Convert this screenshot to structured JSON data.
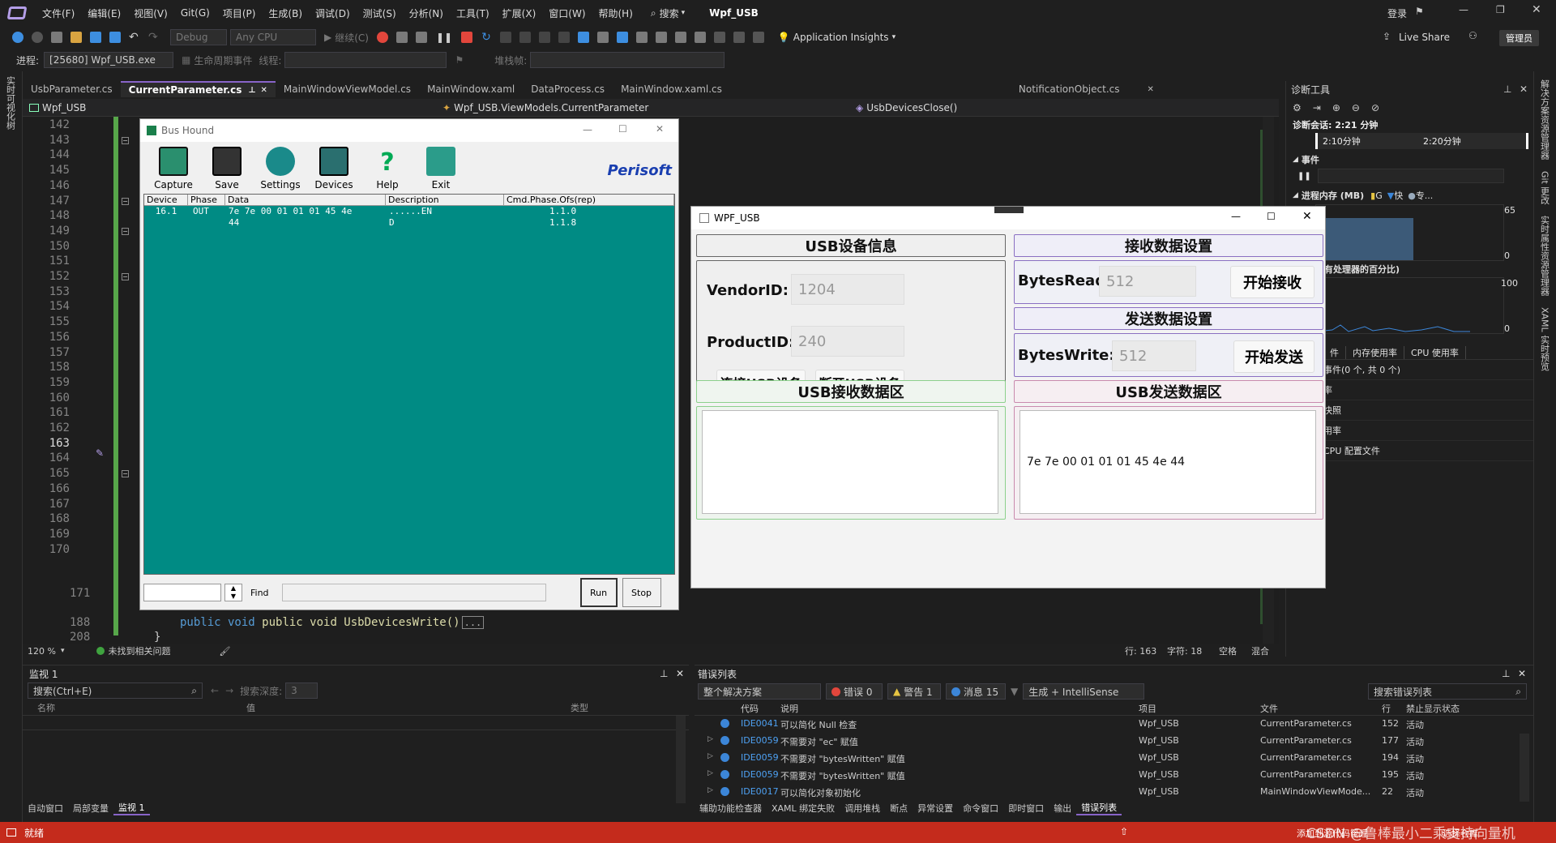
{
  "menubar": {
    "items": [
      "文件(F)",
      "编辑(E)",
      "视图(V)",
      "Git(G)",
      "项目(P)",
      "生成(B)",
      "调试(D)",
      "测试(S)",
      "分析(N)",
      "工具(T)",
      "扩展(X)",
      "窗口(W)",
      "帮助(H)"
    ],
    "search_label": "搜索",
    "solution_title": "Wpf_USB",
    "login_label": "登录",
    "admin_badge": "管理员"
  },
  "toolbar": {
    "config": "Debug",
    "platform": "Any CPU",
    "continue_label": "继续(C)",
    "app_insights": "Application Insights",
    "live_share": "Live Share"
  },
  "procbar": {
    "process_label": "进程:",
    "process_value": "[25680] Wpf_USB.exe",
    "lifecycle_label": "生命周期事件",
    "thread_label": "线程:",
    "stackframe_label": "堆栈帧:"
  },
  "left_strip": {
    "label": "实时可视化树"
  },
  "right_strip": {
    "labels": [
      "解决方案资源管理器",
      "Git 更改",
      "实时属性资源管理器",
      "XAML 实时预览"
    ]
  },
  "editor_tabs": [
    "UsbParameter.cs",
    "CurrentParameter.cs",
    "MainWindowViewModel.cs",
    "MainWindow.xaml",
    "DataProcess.cs",
    "MainWindow.xaml.cs",
    "NotificationObject.cs"
  ],
  "active_tab": "CurrentParameter.cs",
  "navbar": {
    "project": "Wpf_USB",
    "class": "Wpf_USB.ViewModels.CurrentParameter",
    "member": "UsbDevicesClose()"
  },
  "editor": {
    "line_numbers": [
      "142",
      "143",
      "144",
      "145",
      "146",
      "147",
      "148",
      "149",
      "150",
      "151",
      "152",
      "153",
      "154",
      "155",
      "156",
      "157",
      "158",
      "159",
      "160",
      "161",
      "162",
      "163",
      "164",
      "165",
      "166",
      "167",
      "168",
      "169",
      "170"
    ],
    "line_171": "171",
    "line_188": "188",
    "line_208": "208",
    "code_188": "public void UsbDevicesWrite()",
    "code_188_collapsed": "...",
    "code_208": "}"
  },
  "editor_status": {
    "zoom": "120 %",
    "issues": "未找到相关问题",
    "line": "行: 163",
    "char": "字符: 18",
    "ws": "空格",
    "eol": "混合"
  },
  "bushound": {
    "title": "Bus Hound",
    "buttons": [
      "Capture",
      "Save",
      "Settings",
      "Devices",
      "Help",
      "Exit"
    ],
    "logo": "Perisoft",
    "columns": [
      "Device",
      "Phase",
      "Data",
      "Description",
      "Cmd.Phase.Ofs(rep)"
    ],
    "rows": [
      {
        "device": "16.1",
        "phase": "OUT",
        "data": "7e 7e 00 01  01 01 45 4e",
        "desc": "......EN",
        "cmd": "1.1.0"
      },
      {
        "device": "",
        "phase": "",
        "data": "44",
        "desc": "D",
        "cmd": "1.1.8"
      }
    ],
    "find_label": "Find",
    "run_label": "Run",
    "stop_label": "Stop"
  },
  "wpf": {
    "title": "WPF_USB",
    "usb_info_header": "USB设备信息",
    "vendor_label": "VendorID:",
    "vendor_value": "1204",
    "product_label": "ProductID:",
    "product_value": "240",
    "connect_btn": "连接USB设备",
    "disconnect_btn": "断开USB设备",
    "recv_settings_header": "接收数据设置",
    "bytes_read_label": "BytesRead:",
    "bytes_read_value": "512",
    "start_recv_btn": "开始接收",
    "send_settings_header": "发送数据设置",
    "bytes_write_label": "BytesWrite:",
    "bytes_write_value": "512",
    "start_send_btn": "开始发送",
    "recv_area_header": "USB接收数据区",
    "send_area_header": "USB发送数据区",
    "send_area_text": "7e 7e 00 01 01 01 45 4e 44"
  },
  "diag": {
    "title": "诊断工具",
    "session": "诊断会话: 2:21 分钟",
    "tick1": "2:10分钟",
    "tick2": "2:20分钟",
    "events_label": "事件",
    "memory_label": "进程内存 (MB)",
    "legend": [
      "G",
      "快",
      "专..."
    ],
    "mem_max": "65",
    "mem_min": "0",
    "cpu_label": "所有处理器的百分比)",
    "cpu_max": "100",
    "cpu_min": "0",
    "tabs": [
      "件",
      "内存使用率",
      "CPU 使用率"
    ],
    "items": [
      "事件(0 个, 共 0 个)",
      "率",
      "快照",
      "用率",
      "CPU 配置文件"
    ]
  },
  "watch": {
    "title": "监视 1",
    "search_placeholder": "搜索(Ctrl+E)",
    "depth_label": "搜索深度:",
    "depth_value": "3",
    "columns": [
      "名称",
      "值",
      "类型"
    ],
    "bottom_tabs": [
      "自动窗口",
      "局部变量",
      "监视 1"
    ]
  },
  "errlist": {
    "title": "错误列表",
    "scope": "整个解决方案",
    "errors": "错误 0",
    "warnings": "警告 1",
    "messages": "消息 15",
    "build_filter": "生成 + IntelliSense",
    "search_placeholder": "搜索错误列表",
    "columns": [
      "代码",
      "说明",
      "项目",
      "文件",
      "行",
      "禁止显示状态"
    ],
    "rows": [
      {
        "code": "IDE0041",
        "desc": "可以简化 Null 检查",
        "project": "Wpf_USB",
        "file": "CurrentParameter.cs",
        "line": "152",
        "state": "活动"
      },
      {
        "code": "IDE0059",
        "desc": "不需要对 \"ec\" 赋值",
        "project": "Wpf_USB",
        "file": "CurrentParameter.cs",
        "line": "177",
        "state": "活动"
      },
      {
        "code": "IDE0059",
        "desc": "不需要对 \"bytesWritten\" 赋值",
        "project": "Wpf_USB",
        "file": "CurrentParameter.cs",
        "line": "194",
        "state": "活动"
      },
      {
        "code": "IDE0059",
        "desc": "不需要对 \"bytesWritten\" 赋值",
        "project": "Wpf_USB",
        "file": "CurrentParameter.cs",
        "line": "195",
        "state": "活动"
      },
      {
        "code": "IDE0017",
        "desc": "可以简化对象初始化",
        "project": "Wpf_USB",
        "file": "MainWindowViewMode...",
        "line": "22",
        "state": "活动"
      }
    ],
    "bottom_tabs": [
      "辅助功能检查器",
      "XAML 绑定失败",
      "调用堆栈",
      "断点",
      "异常设置",
      "命令窗口",
      "即时窗口",
      "输出",
      "错误列表"
    ]
  },
  "statusbar": {
    "ready": "就绪",
    "add_source": "添加到源代码管理",
    "select_repo": "选择仓库",
    "watermark": "CSDN @鲁棒最小二乘支持向量机"
  }
}
